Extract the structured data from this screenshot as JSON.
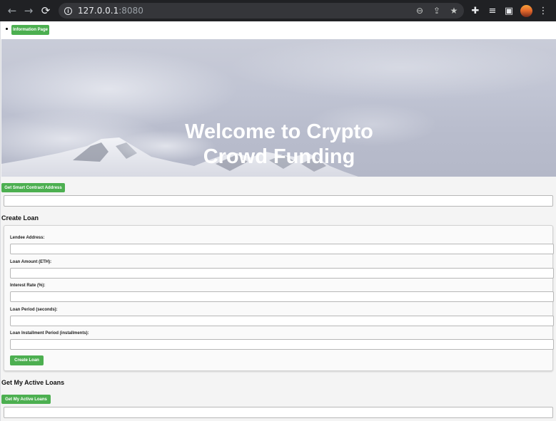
{
  "browser": {
    "url_host": "127.0.0.1",
    "url_port": ":8080",
    "back_icon": "←",
    "forward_icon": "→",
    "reload_icon": "⟳",
    "info_icon": "i",
    "zoom_icon": "⊖",
    "share_icon": "⇪",
    "bookmark_icon": "★",
    "extensions_icon": "✚",
    "media_icon": "≡",
    "sidepanel_icon": "▣",
    "menu_icon": "⋮"
  },
  "nav": {
    "information_button": "Information Page"
  },
  "hero": {
    "title_line1": "Welcome to Crypto",
    "title_line2": "Crowd Funding"
  },
  "contract": {
    "button": "Get Smart Contract Address",
    "value": ""
  },
  "create_loan": {
    "title": "Create Loan",
    "fields": [
      {
        "label": "Lendee Address:",
        "value": ""
      },
      {
        "label": "Loan Amount (ETH):",
        "value": ""
      },
      {
        "label": "Interest Rate (%):",
        "value": ""
      },
      {
        "label": "Loan Period (seconds):",
        "value": ""
      },
      {
        "label": "Loan Installment Period (installments):",
        "value": ""
      }
    ],
    "submit": "Create Loan"
  },
  "active_loans": {
    "title": "Get My Active Loans",
    "button": "Get My Active Loans",
    "value": ""
  },
  "colors": {
    "accent": "#4caf50",
    "chrome": "#202124"
  }
}
